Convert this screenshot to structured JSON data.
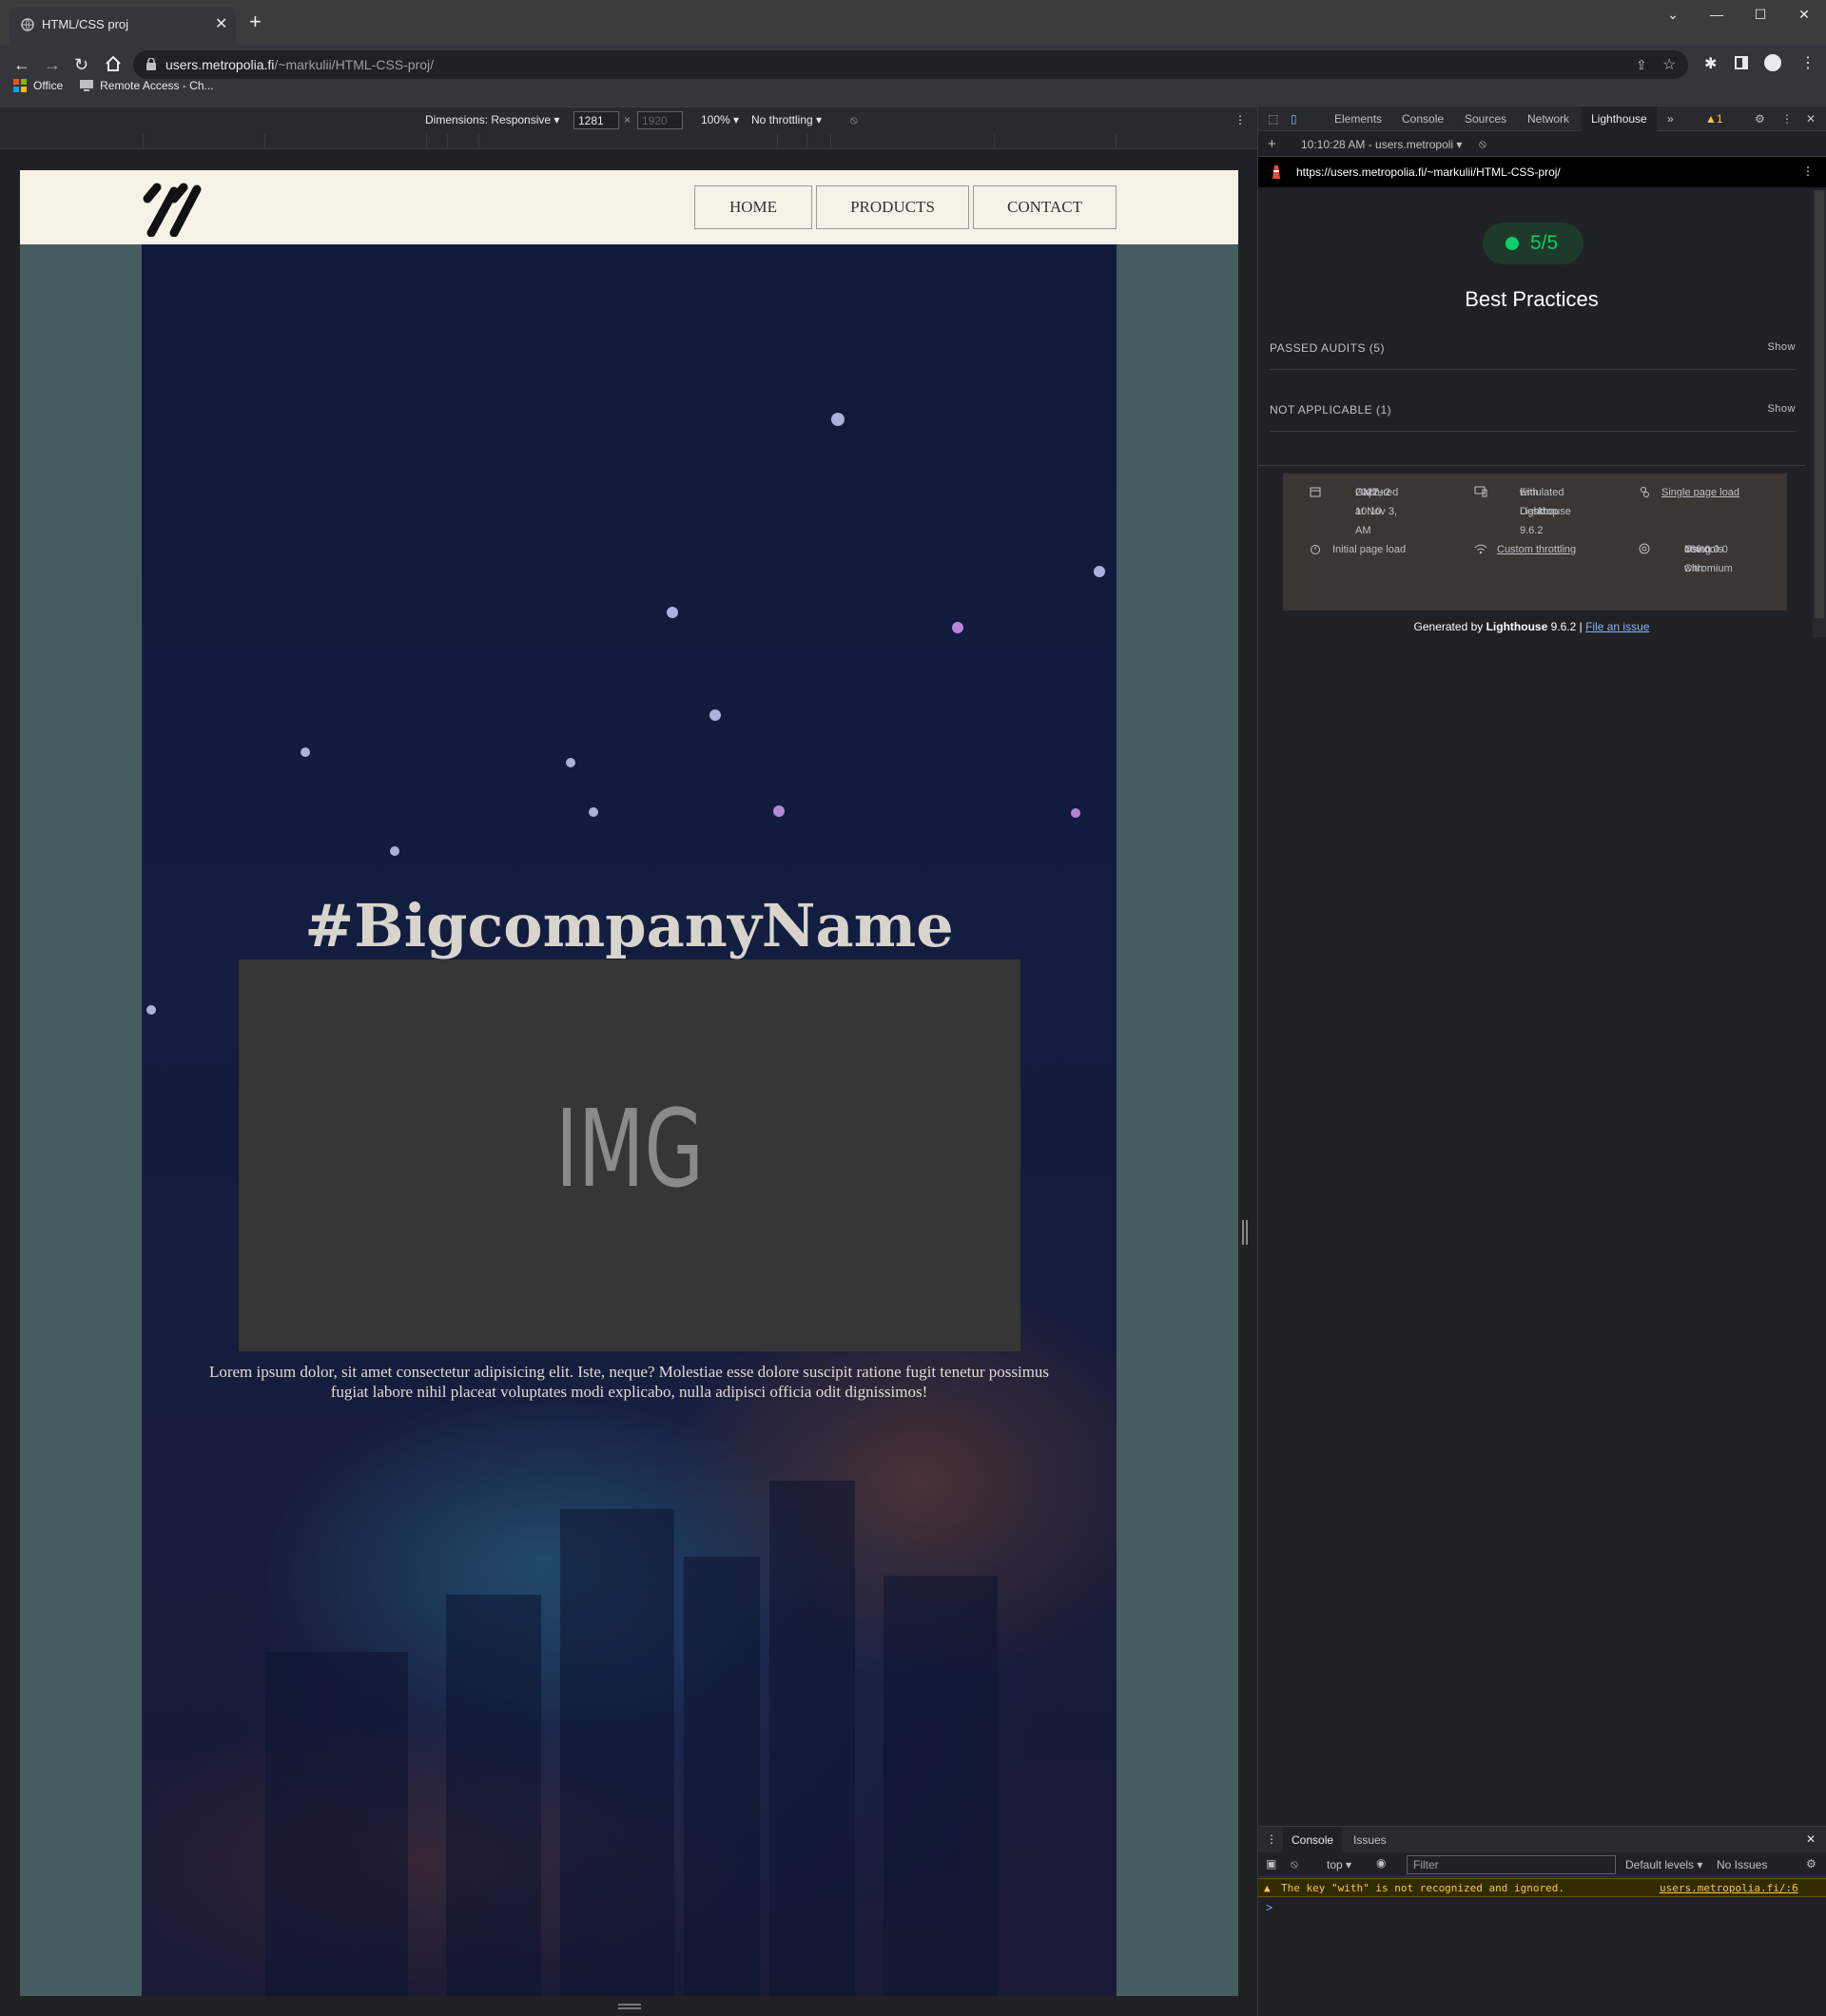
{
  "browser": {
    "tab_title": "HTML/CSS proj",
    "new_tab": "+",
    "url_host": "users.metropolia.fi",
    "url_path": "/~markulii/HTML-CSS-proj/",
    "bookmarks": [
      "Office",
      "Remote Access - Ch..."
    ]
  },
  "device_toolbar": {
    "dimensions": "Dimensions: Responsive",
    "width": "1281",
    "height": "1920",
    "times": "×",
    "zoom": "100%",
    "throttling": "No throttling"
  },
  "page": {
    "nav": [
      "HOME",
      "PRODUCTS",
      "CONTACT"
    ],
    "title": "#BigcompanyName",
    "img_placeholder": "IMG",
    "lorem": "Lorem ipsum dolor, sit amet consectetur adipisicing elit. Iste, neque? Molestiae esse dolore suscipit ratione fugit tenetur possimus fugiat labore nihil placeat voluptates modi explicabo, nulla adipisci officia odit dignissimos!"
  },
  "devtools": {
    "tabs": [
      "Elements",
      "Console",
      "Sources",
      "Network",
      "Lighthouse"
    ],
    "more": "»",
    "warnings_count": "1",
    "report_select": "10:10:28 AM - users.metropoli",
    "report_url": "https://users.metropolia.fi/~markulii/HTML-CSS-proj/",
    "score": "5/5",
    "category": "Best Practices",
    "groups": [
      {
        "label": "PASSED AUDITS (5)",
        "action": "Show"
      },
      {
        "label": "NOT APPLICABLE (1)",
        "action": "Show"
      }
    ],
    "meta": {
      "captured": [
        "Captured at Nov 3,",
        "2022, 10:10 AM",
        "GMT+2"
      ],
      "emulated": [
        "Emulated Desktop",
        "with Lighthouse 9.6.2"
      ],
      "single": "Single page load",
      "initial": "Initial page load",
      "throttling": "Custom throttling",
      "chromium": [
        "Using Chromium",
        "106.0.0.0 with",
        "devtools"
      ]
    },
    "generated_prefix": "Generated by ",
    "generated_brand": "Lighthouse",
    "generated_version": " 9.6.2 | ",
    "generated_link": "File an issue",
    "drawer": {
      "tabs": [
        "Console",
        "Issues"
      ],
      "context": "top",
      "filter_placeholder": "Filter",
      "levels": "Default levels",
      "issues": "No Issues",
      "warning": "The key \"with\" is not recognized and ignored.",
      "warning_source": "users.metropolia.fi/:6",
      "prompt": ">"
    }
  },
  "colors": {
    "page_bg": "#455d61",
    "header_bg": "#f7f2e8",
    "score_green": "#0cce6b",
    "link_blue": "#8ab4f8"
  }
}
